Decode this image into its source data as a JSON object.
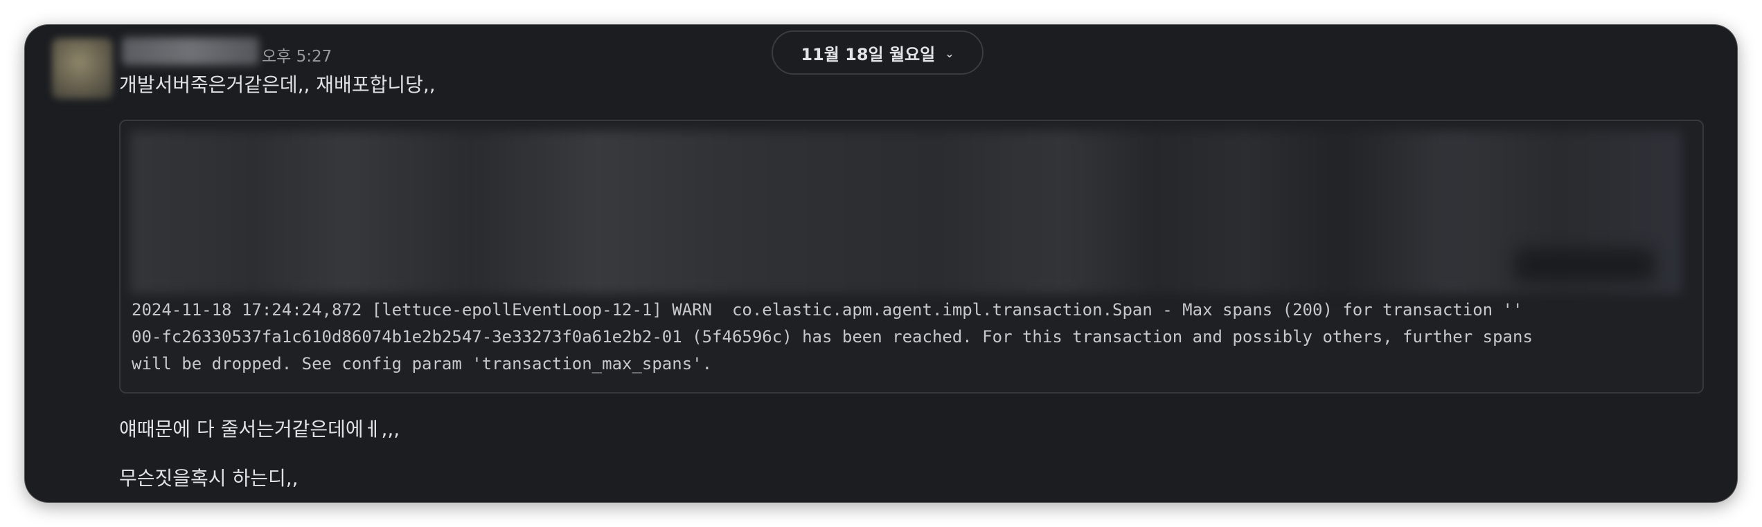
{
  "message": {
    "timestamp": "오후 5:27",
    "date_divider": "11월 18일 월요일",
    "texts": [
      "개발서버죽은거같은데,, 재배포합니당,,",
      "얘때문에 다 줄서는거같은데에ㅔ,,,",
      "무슨짓을혹시 하는디,,"
    ],
    "code_lines": [
      "2024-11-18 17:24:24,872 [lettuce-epollEventLoop-12-1] WARN  co.elastic.apm.agent.impl.transaction.Span - Max spans (200) for transaction ''",
      "00-fc26330537fa1c610d86074b1e2b2547-3e33273f0a61e2b2-01 (5f46596c) has been reached. For this transaction and possibly others, further spans",
      "will be dropped. See config param 'transaction_max_spans'."
    ]
  },
  "icons": {
    "date_chevron": "chevron-down-icon",
    "avatar": "user-avatar"
  },
  "colors": {
    "background": "#1b1d21",
    "text": "#e1e2e3",
    "muted": "#9a9b9d",
    "code_border": "#36383d"
  }
}
